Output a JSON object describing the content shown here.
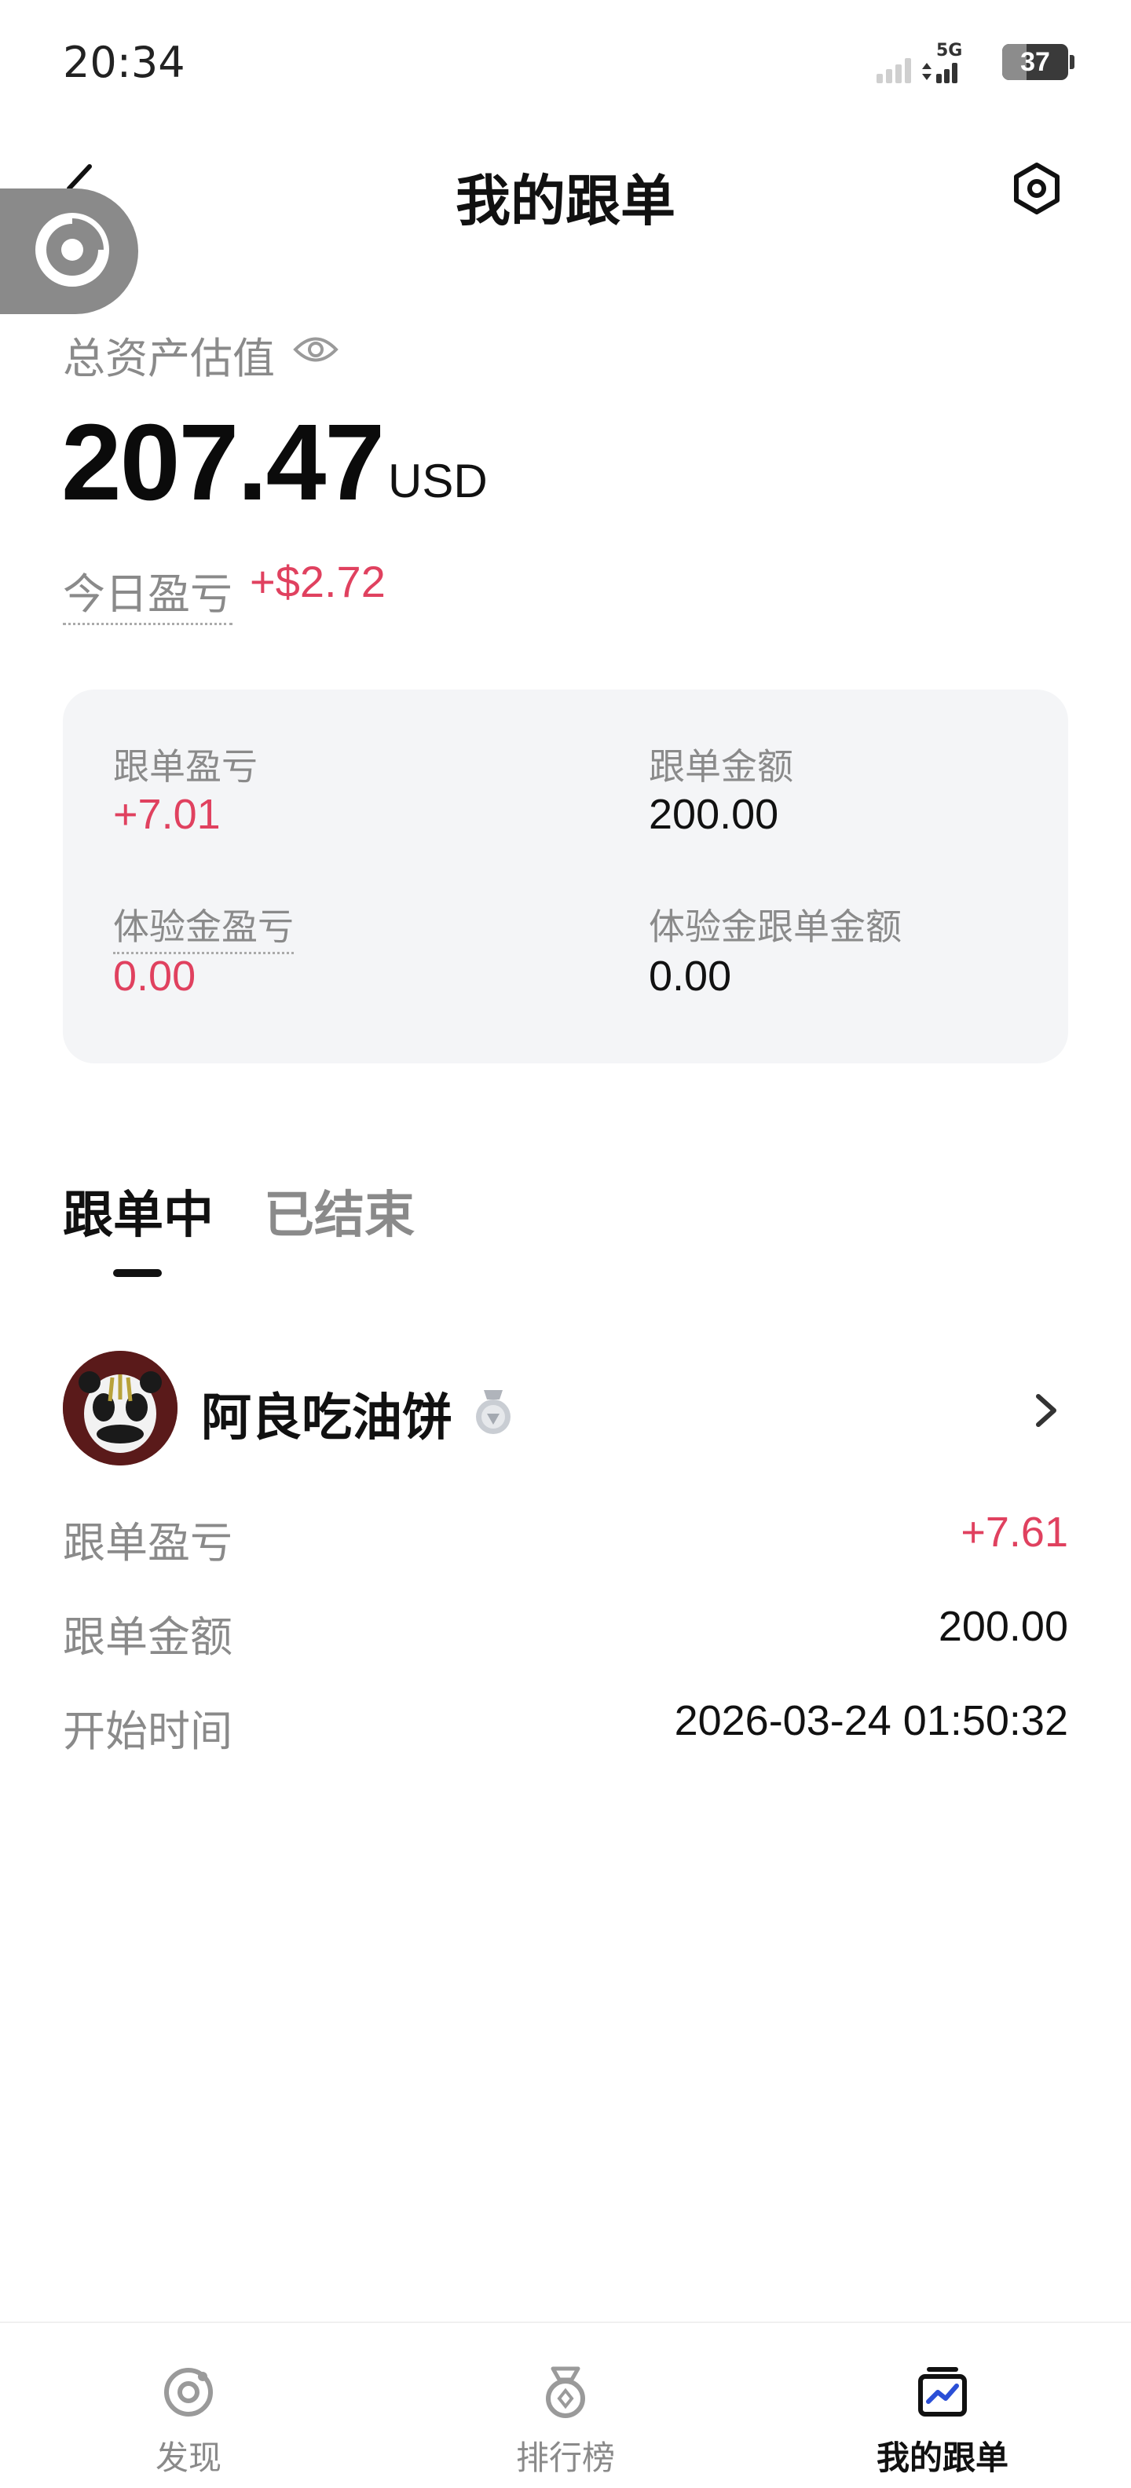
{
  "status_bar": {
    "time": "20:34",
    "network": "5G",
    "battery": "37",
    "battery_level": 0.37
  },
  "header": {
    "title": "我的跟单",
    "back_icon": "chevron-left-icon",
    "settings_icon": "settings-hexagon-icon"
  },
  "assets": {
    "label": "总资产估值",
    "value": "207.47",
    "unit": "USD",
    "today_label": "今日盈亏",
    "today_value": "+$2.72"
  },
  "summary": {
    "copy_pnl_label": "跟单盈亏",
    "copy_pnl_value": "+7.01",
    "copy_amount_label": "跟单金额",
    "copy_amount_value": "200.00",
    "trial_pnl_label": "体验金盈亏",
    "trial_pnl_value": "0.00",
    "trial_amount_label": "体验金跟单金额",
    "trial_amount_value": "0.00"
  },
  "tabs": [
    {
      "label": "跟单中",
      "active": true
    },
    {
      "label": "已结束",
      "active": false
    }
  ],
  "trader": {
    "name": "阿良吃油饼",
    "badge_icon": "silver-medal-icon",
    "rows": [
      {
        "label": "跟单盈亏",
        "value": "+7.61"
      },
      {
        "label": "跟单金额",
        "value": "200.00"
      },
      {
        "label": "开始时间",
        "value": "2026-03-24 01:50:32"
      }
    ]
  },
  "bottom_nav": [
    {
      "label": "发现",
      "icon": "discover-icon",
      "active": false
    },
    {
      "label": "排行榜",
      "icon": "ranking-medal-icon",
      "active": false
    },
    {
      "label": "我的跟单",
      "icon": "my-copy-trading-icon",
      "active": true
    }
  ],
  "colors": {
    "profit": "#e0415f",
    "muted": "#8a8a8a",
    "card_bg": "#f4f5f7",
    "nav_active_accent": "#2b4fd6"
  }
}
